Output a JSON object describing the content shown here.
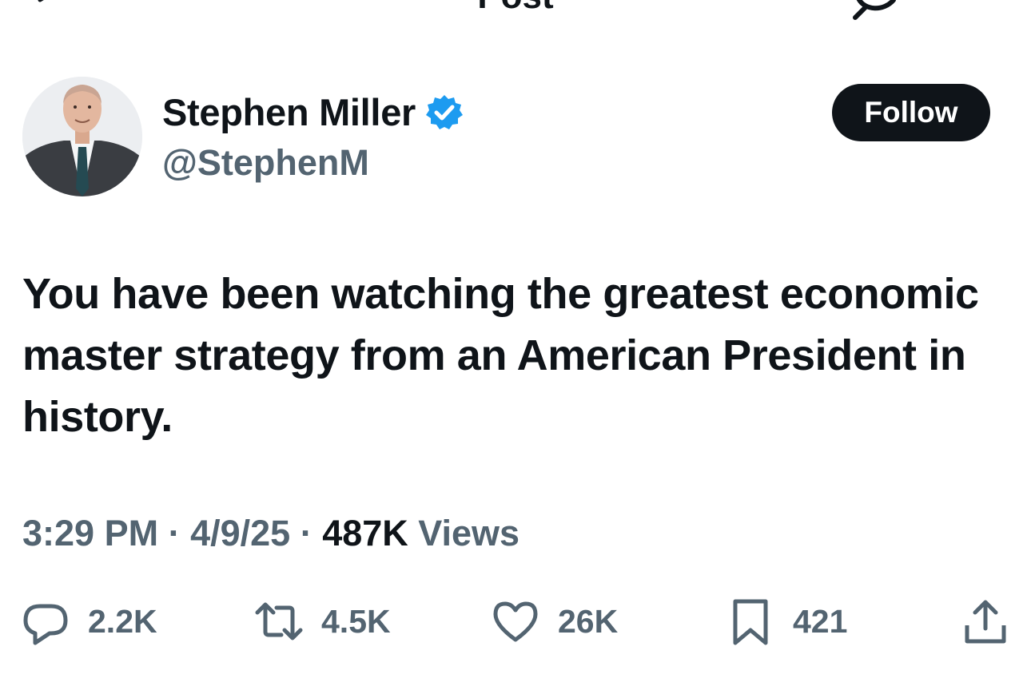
{
  "header": {
    "title": "Post",
    "back_icon": "arrow-left-icon",
    "top_right_icon": "reply-icon"
  },
  "author": {
    "name": "Stephen Miller",
    "handle": "@StephenM",
    "verified_icon": "verified-badge-icon",
    "verified_color": "#1d9bf0"
  },
  "follow_button": {
    "label": "Follow"
  },
  "post": {
    "text": "You have been watching the greatest economic master strategy from an American President in history."
  },
  "meta": {
    "time": "3:29 PM",
    "sep1": " · ",
    "date": "4/9/25",
    "sep2": " · ",
    "views_count": "487K",
    "views_label": " Views"
  },
  "actions": {
    "reply": {
      "icon": "reply-icon",
      "count": "2.2K"
    },
    "repost": {
      "icon": "repost-icon",
      "count": "4.5K"
    },
    "like": {
      "icon": "heart-icon",
      "count": "26K"
    },
    "bookmark": {
      "icon": "bookmark-icon",
      "count": "421"
    },
    "share": {
      "icon": "share-icon"
    }
  },
  "colors": {
    "text_primary": "#0f1419",
    "text_secondary": "#536471",
    "follow_bg": "#0f1419"
  }
}
